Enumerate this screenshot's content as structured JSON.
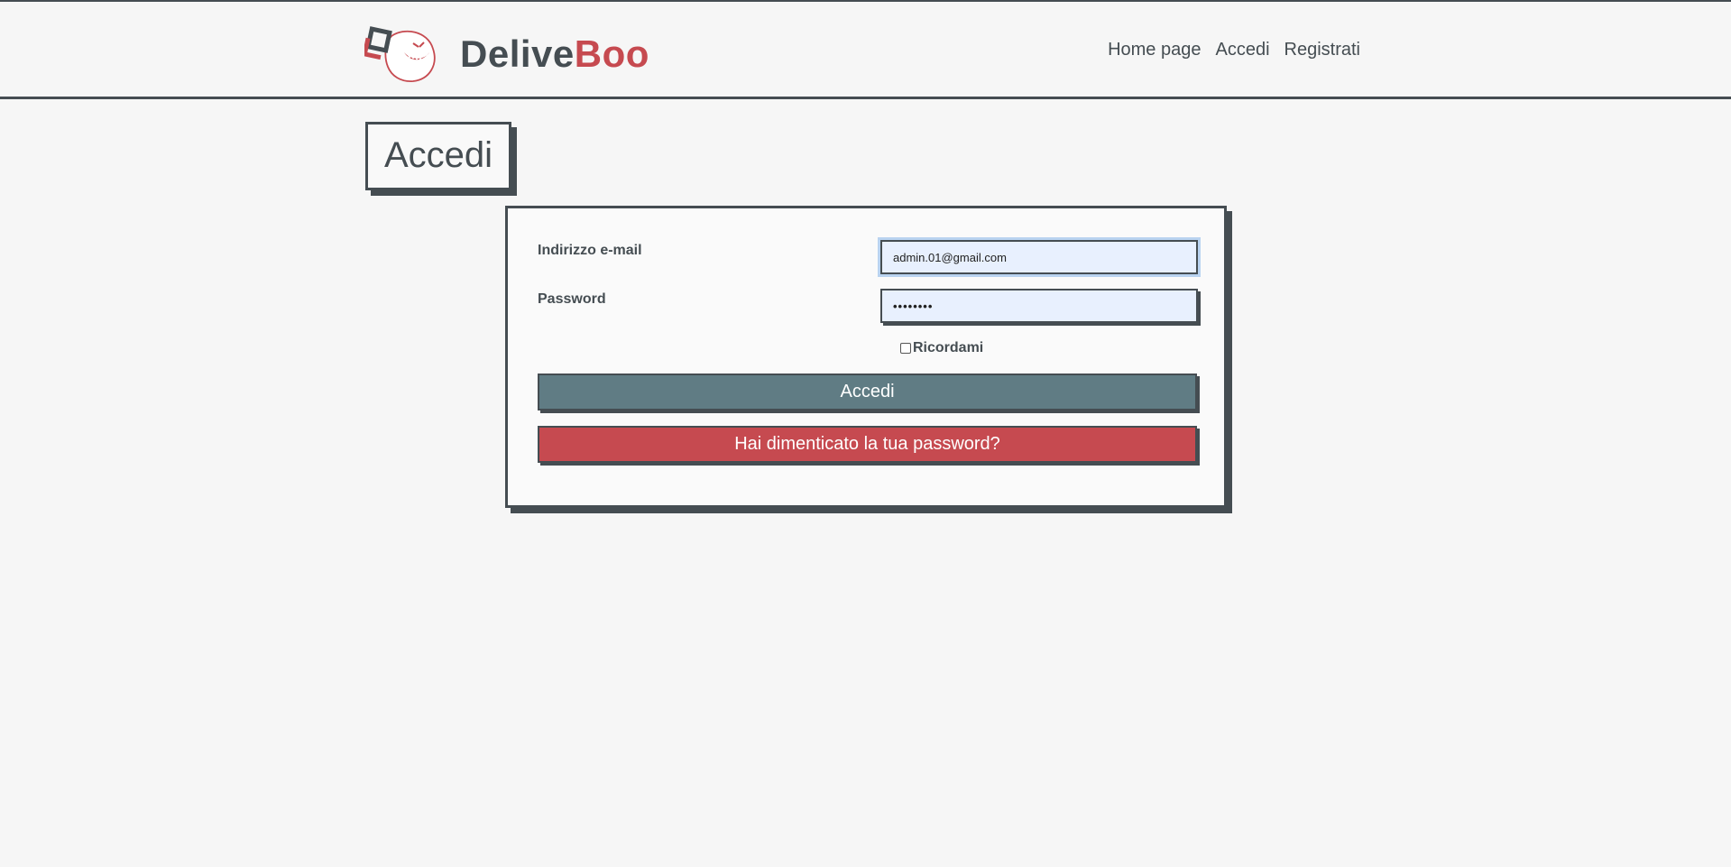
{
  "brand": {
    "name_part1": "Delive",
    "name_part2": "Boo",
    "logo_icon": "ghost-delivery-logo-icon"
  },
  "nav": {
    "items": [
      {
        "label": "Home page"
      },
      {
        "label": "Accedi"
      },
      {
        "label": "Registrati"
      }
    ]
  },
  "page": {
    "title": "Accedi"
  },
  "form": {
    "email_label": "Indirizzo e-mail",
    "email_value": "admin.01@gmail.com",
    "password_label": "Password",
    "password_value": "••••••••",
    "remember_label": "Ricordami",
    "remember_checked": false,
    "submit_label": "Accedi",
    "forgot_label": "Hai dimenticato la tua password?"
  },
  "colors": {
    "dark": "#454d52",
    "accent_red": "#c64a50",
    "primary_button": "#607c84",
    "background": "#f6f6f6",
    "autofill_input": "#e8f0fe"
  }
}
